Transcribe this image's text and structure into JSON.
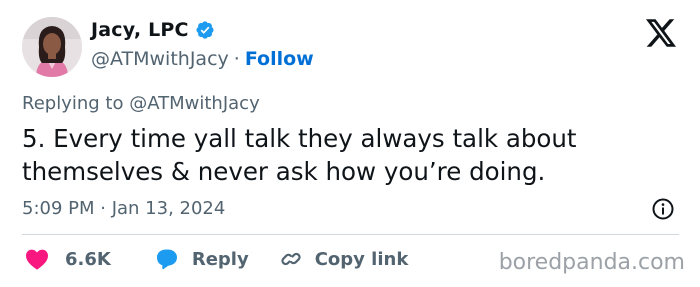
{
  "author": {
    "display_name": "Jacy, LPC",
    "handle": "@ATMwithJacy",
    "separator": "·",
    "follow_label": "Follow",
    "verified_color": "#1d9bf0"
  },
  "tweet": {
    "replying_to": "Replying to @ATMwithJacy",
    "text": "5. Every time yall talk they always talk about themselves & never ask how you’re doing.",
    "timestamp": "5:09 PM · Jan 13, 2024"
  },
  "actions": {
    "like_count": "6.6K",
    "reply_label": "Reply",
    "copy_link_label": "Copy link"
  },
  "icons": {
    "platform": "x-logo-icon",
    "verified": "verified-badge-icon",
    "info": "info-icon",
    "like": "heart-icon",
    "reply": "speech-bubble-icon",
    "copy": "link-icon"
  },
  "colors": {
    "like": "#f91880",
    "reply": "#1d9bf0",
    "follow": "#006fd6",
    "secondary_text": "#536471"
  },
  "watermark": "boredpanda.com"
}
